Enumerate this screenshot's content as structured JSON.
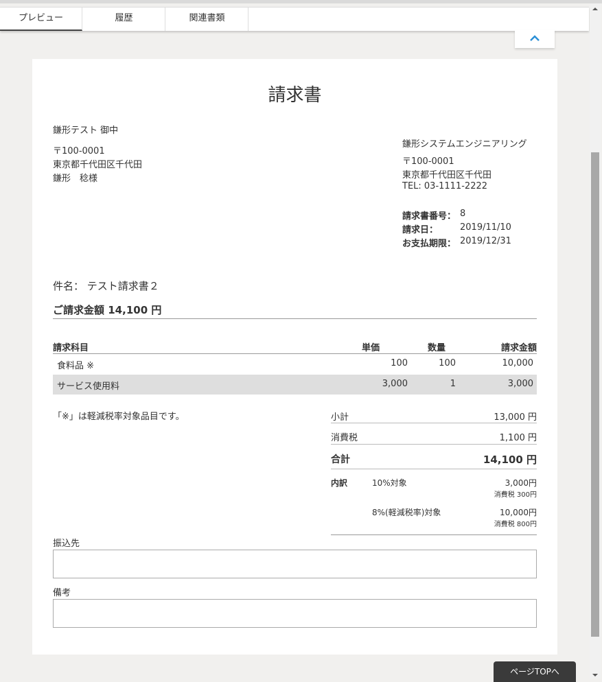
{
  "tabs": [
    {
      "label": "プレビュー"
    },
    {
      "label": "履歴"
    },
    {
      "label": "関連書類"
    }
  ],
  "page_top_label": "ページTOPへ",
  "invoice": {
    "title": "請求書",
    "recipient": {
      "name": "鎌形テスト 御中",
      "postal": "〒100-0001",
      "address": "東京都千代田区千代田",
      "person": "鎌形　稔様"
    },
    "issuer": {
      "name": "鎌形システムエンジニアリング",
      "postal": "〒100-0001",
      "address": "東京都千代田区千代田",
      "tel": "TEL: 03-1111-2222"
    },
    "meta": {
      "number_label": "請求書番号：",
      "number_value": "8",
      "date_label": "請求日：",
      "date_value": "2019/11/10",
      "due_label": "お支払期限：",
      "due_value": "2019/12/31"
    },
    "subject_label": "件名：",
    "subject_value": "テスト請求書２",
    "total_label": "ご請求金額",
    "total_value": "14,100 円",
    "table": {
      "headers": [
        "請求科目",
        "単価",
        "数量",
        "請求金額"
      ],
      "rows": [
        [
          "食料品 ※",
          "100",
          "100",
          "10,000"
        ],
        [
          "サービス使用料",
          "3,000",
          "1",
          "3,000"
        ]
      ]
    },
    "note": "「※」は軽減税率対象品目です。",
    "summary": {
      "subtotal_label": "小計",
      "subtotal_value": "13,000 円",
      "tax_label": "消費税",
      "tax_value": "1,100 円",
      "total_label": "合計",
      "total_value": "14,100 円"
    },
    "breakdown": {
      "label": "内訳",
      "items": [
        {
          "name": "10%対象",
          "amount": "3,000円",
          "tax": "消費税 300円"
        },
        {
          "name": "8%(軽減税率)対象",
          "amount": "10,000円",
          "tax": "消費税 800円"
        }
      ]
    },
    "bank_label": "振込先",
    "bank_value": "",
    "remarks_label": "備考",
    "remarks_value": ""
  }
}
